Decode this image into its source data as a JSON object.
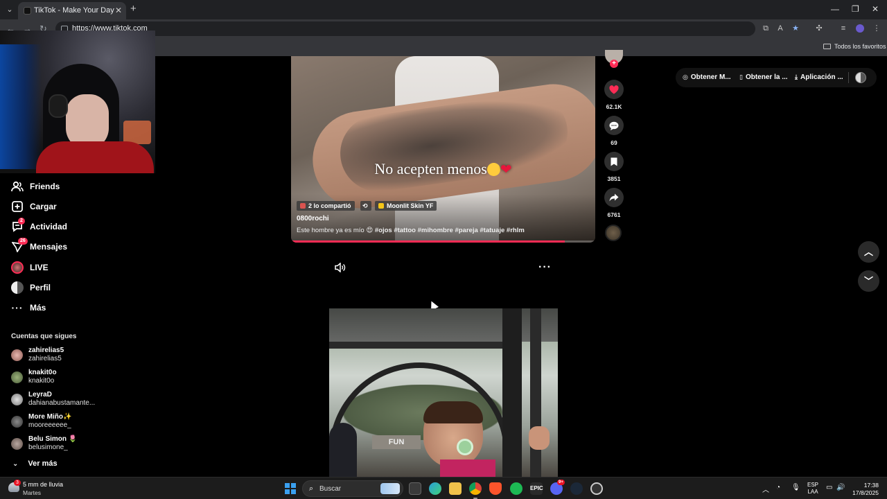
{
  "browser": {
    "tab_title": "TikTok - Make Your Day",
    "url": "https://www.tiktok.com",
    "bookmarks_all": "Todos los favoritos"
  },
  "sidebar": {
    "items": [
      {
        "label": "Friends",
        "icon": "friends-icon"
      },
      {
        "label": "Cargar",
        "icon": "upload-icon"
      },
      {
        "label": "Actividad",
        "icon": "activity-icon",
        "badge": "2"
      },
      {
        "label": "Mensajes",
        "icon": "messages-icon",
        "badge": "26"
      },
      {
        "label": "LIVE",
        "icon": "live-avatar"
      },
      {
        "label": "Perfil",
        "icon": "profile-avatar"
      },
      {
        "label": "Más",
        "icon": "more-icon"
      }
    ],
    "following_title": "Cuentas que sigues",
    "following": [
      {
        "username": "zahirelias5",
        "nickname": "zahirelias5"
      },
      {
        "username": "knakit0o",
        "nickname": "knakit0o"
      },
      {
        "username": "LeyraD",
        "nickname": "dahianabustamante..."
      },
      {
        "username": "More Miño✨",
        "nickname": "mooreeeeee_"
      },
      {
        "username": "Belu Simon 🌷",
        "nickname": "belusimone_"
      }
    ],
    "see_more": "Ver más"
  },
  "video1": {
    "caption_overlay": "No acepten menos",
    "chip_shared": "2 lo compartió",
    "chip_effect": "Moonlit Skin YF",
    "author": "0800rochi",
    "description_text": "Este hombre ya es mío 😍",
    "hashtags": "#ojos #tattoo #mihombre #pareja #tatuaje #rhlm",
    "progress": 0.9,
    "likes": "62.1K",
    "comments": "69",
    "saves": "3851",
    "shares": "6761"
  },
  "video2": {
    "sign_text": "FUN"
  },
  "header": {
    "get_coins": "Obtener M...",
    "get_app": "Obtener la ...",
    "app": "Aplicación ..."
  },
  "taskbar": {
    "weather_line1": "5 mm de lluvia",
    "weather_line2": "Martes",
    "weather_badge": "3",
    "search_placeholder": "Buscar",
    "discord_badge": "9+",
    "lang_line1": "ESP",
    "lang_line2": "LAA",
    "time": "17:38",
    "date": "17/8/2025"
  },
  "colors": {
    "accent": "#fe2c55",
    "background": "#000000",
    "chrome": "#35363a"
  }
}
